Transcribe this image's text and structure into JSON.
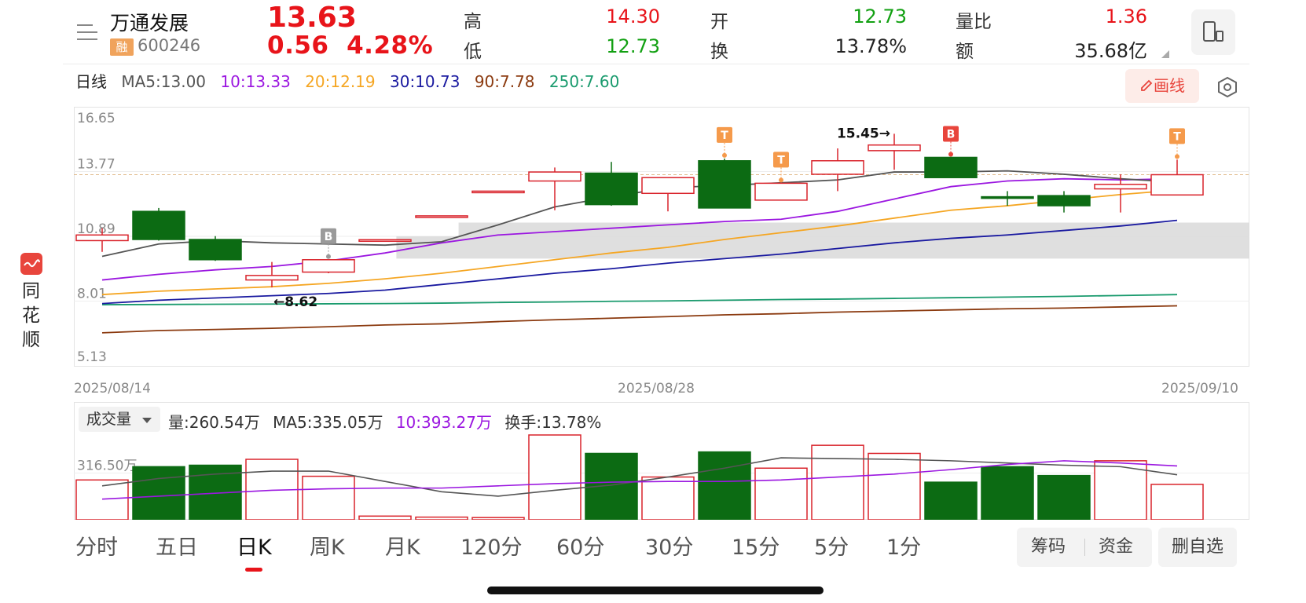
{
  "stock": {
    "name": "万通发展",
    "badge": "融",
    "code": "600246",
    "price": "13.63",
    "change": "0.56",
    "change_pct": "4.28%"
  },
  "quote": {
    "high_label": "高",
    "high": "14.30",
    "low_label": "低",
    "low": "12.73",
    "open_label": "开",
    "open": "12.73",
    "turnover_label": "换",
    "turnover": "13.78%",
    "vol_ratio_label": "量比",
    "vol_ratio": "1.36",
    "amount_label": "额",
    "amount": "35.68亿"
  },
  "ma_legend": {
    "period": "日线",
    "ma5": "MA5:13.00",
    "ma10": "10:13.33",
    "ma20": "20:12.19",
    "ma30": "30:10.73",
    "ma90": "90:7.78",
    "ma250": "250:7.60"
  },
  "colors": {
    "up": "#d9232b",
    "down": "#0c6b13",
    "ma5": "#555555",
    "ma10": "#9b17e0",
    "ma20": "#f5a623",
    "ma30": "#1a1aa0",
    "ma90": "#8b3a0f",
    "ma250": "#1a9b6e"
  },
  "toolbar": {
    "draw_label": "画线"
  },
  "brand": {
    "name": "同花顺"
  },
  "chart_data": {
    "type": "candlestick",
    "ylim": [
      5.13,
      16.65
    ],
    "y_ticks": [
      "16.65",
      "13.77",
      "10.89",
      "8.01",
      "5.13"
    ],
    "x_ticks": [
      "2025/08/14",
      "2025/08/28",
      "2025/09/10"
    ],
    "current_price_line": 13.63,
    "annotations": {
      "high_label": "15.45→",
      "low_label": "←8.62"
    },
    "candles": [
      {
        "o": 10.7,
        "h": 11.25,
        "l": 10.2,
        "c": 10.95
      },
      {
        "o": 12.0,
        "h": 12.15,
        "l": 10.7,
        "c": 10.75
      },
      {
        "o": 10.75,
        "h": 10.9,
        "l": 9.8,
        "c": 9.85
      },
      {
        "o": 8.95,
        "h": 9.75,
        "l": 8.62,
        "c": 9.15
      },
      {
        "o": 9.3,
        "h": 9.85,
        "l": 9.25,
        "c": 9.85
      },
      {
        "o": 10.74,
        "h": 10.74,
        "l": 10.74,
        "c": 10.74
      },
      {
        "o": 11.8,
        "h": 11.8,
        "l": 11.8,
        "c": 11.8
      },
      {
        "o": 12.9,
        "h": 12.9,
        "l": 12.9,
        "c": 12.9
      },
      {
        "o": 13.35,
        "h": 13.95,
        "l": 12.05,
        "c": 13.75
      },
      {
        "o": 13.7,
        "h": 14.2,
        "l": 12.25,
        "c": 12.3
      },
      {
        "o": 12.8,
        "h": 13.25,
        "l": 12.0,
        "c": 13.5
      },
      {
        "o": 14.25,
        "h": 14.35,
        "l": 12.2,
        "c": 12.15
      },
      {
        "o": 12.5,
        "h": 13.25,
        "l": 12.5,
        "c": 13.25
      },
      {
        "o": 13.65,
        "h": 14.8,
        "l": 12.9,
        "c": 14.25
      },
      {
        "o": 14.7,
        "h": 15.45,
        "l": 13.85,
        "c": 14.95
      },
      {
        "o": 14.4,
        "h": 14.4,
        "l": 13.5,
        "c": 13.5
      },
      {
        "o": 12.65,
        "h": 12.9,
        "l": 12.25,
        "c": 12.58
      },
      {
        "o": 12.7,
        "h": 12.9,
        "l": 11.95,
        "c": 12.25
      },
      {
        "o": 13.0,
        "h": 13.65,
        "l": 11.95,
        "c": 13.2
      },
      {
        "o": 12.73,
        "h": 14.3,
        "l": 12.73,
        "c": 13.63
      }
    ],
    "ma": {
      "ma5": [
        10.0,
        10.55,
        10.7,
        10.6,
        10.55,
        10.5,
        10.65,
        11.4,
        12.2,
        12.65,
        13.05,
        13.15,
        13.27,
        13.4,
        13.75,
        13.75,
        13.8,
        13.65,
        13.45,
        13.3
      ],
      "ma10": [
        8.95,
        9.2,
        9.4,
        9.55,
        9.8,
        10.15,
        10.6,
        10.95,
        11.1,
        11.25,
        11.4,
        11.55,
        11.65,
        12.0,
        12.55,
        13.1,
        13.35,
        13.45,
        13.4,
        13.45
      ],
      "ma20": [
        8.3,
        8.45,
        8.55,
        8.65,
        8.8,
        9.0,
        9.25,
        9.55,
        9.85,
        10.15,
        10.4,
        10.75,
        11.05,
        11.35,
        11.7,
        12.05,
        12.25,
        12.5,
        12.75,
        12.95
      ],
      "ma30": [
        7.9,
        8.05,
        8.15,
        8.25,
        8.35,
        8.5,
        8.75,
        9.0,
        9.25,
        9.45,
        9.7,
        9.9,
        10.1,
        10.35,
        10.6,
        10.8,
        10.95,
        11.15,
        11.35,
        11.6
      ],
      "ma90": [
        6.6,
        6.7,
        6.75,
        6.8,
        6.87,
        6.95,
        7.0,
        7.1,
        7.18,
        7.25,
        7.32,
        7.4,
        7.45,
        7.52,
        7.57,
        7.62,
        7.67,
        7.7,
        7.75,
        7.8
      ],
      "ma250": [
        7.85,
        7.86,
        7.87,
        7.88,
        7.89,
        7.9,
        7.92,
        7.95,
        7.97,
        8.0,
        8.02,
        8.05,
        8.08,
        8.1,
        8.13,
        8.16,
        8.19,
        8.22,
        8.26,
        8.3
      ]
    },
    "volume": {
      "ylim": [
        0,
        575
      ],
      "tick": "316.50万",
      "tick_value": 316.5,
      "values": [
        270,
        360,
        370,
        410,
        295,
        25,
        18,
        15,
        575,
        450,
        290,
        460,
        350,
        505,
        450,
        255,
        360,
        300,
        400,
        240
      ],
      "up": [
        true,
        false,
        false,
        true,
        true,
        true,
        true,
        true,
        true,
        false,
        true,
        false,
        true,
        true,
        true,
        false,
        false,
        false,
        true,
        true
      ],
      "ma5": [
        230,
        280,
        310,
        330,
        330,
        260,
        190,
        160,
        200,
        235,
        290,
        350,
        420,
        415,
        410,
        400,
        385,
        370,
        360,
        305
      ],
      "ma10": [
        140,
        160,
        180,
        200,
        210,
        215,
        215,
        230,
        245,
        255,
        260,
        260,
        270,
        290,
        310,
        340,
        375,
        400,
        385,
        365
      ]
    },
    "markers": [
      {
        "index": 4,
        "label": "B",
        "kind": "gray"
      },
      {
        "index": 11,
        "label": "T",
        "kind": "orange"
      },
      {
        "index": 12,
        "label": "T",
        "kind": "orange"
      },
      {
        "index": 15,
        "label": "B",
        "kind": "red"
      },
      {
        "index": 19,
        "label": "T",
        "kind": "orange"
      }
    ]
  },
  "volume_panel": {
    "dropdown": "成交量",
    "vol": "量:260.54万",
    "ma5": "MA5:335.05万",
    "ma10": "10:393.27万",
    "turnover": "换手:13.78%"
  },
  "tabs": [
    "分时",
    "五日",
    "日K",
    "周K",
    "月K",
    "120分",
    "60分",
    "30分",
    "15分",
    "5分",
    "1分"
  ],
  "buttons": {
    "chips": "筹码",
    "funds": "资金",
    "remove_fav": "删自选"
  }
}
